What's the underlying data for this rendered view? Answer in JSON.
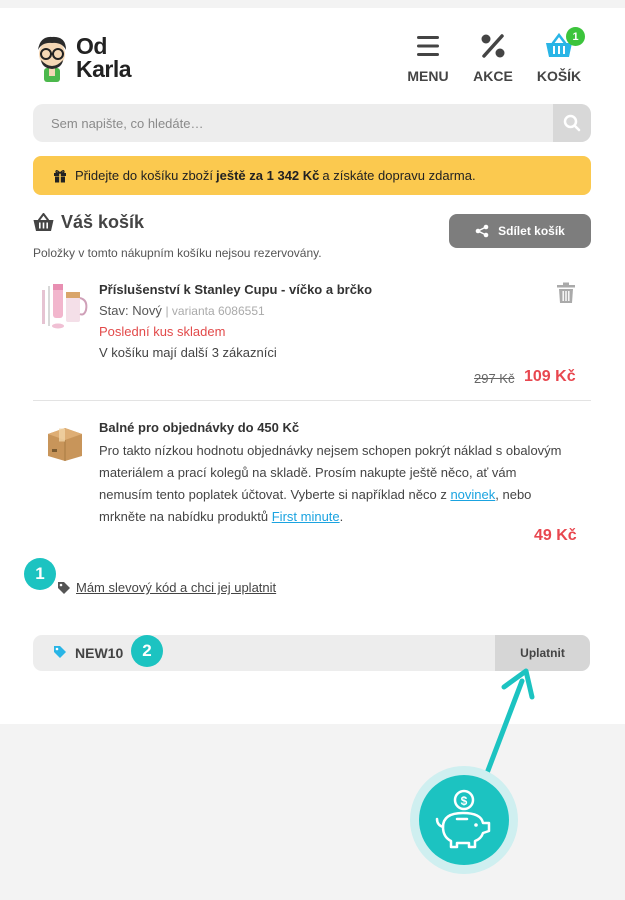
{
  "header": {
    "logo_line1": "Od",
    "logo_line2": "Karla",
    "nav": [
      {
        "label": "MENU",
        "icon": "hamburger-icon"
      },
      {
        "label": "AKCE",
        "icon": "percent-icon"
      },
      {
        "label": "KOŠÍK",
        "icon": "basket-icon",
        "badge": "1"
      }
    ]
  },
  "search": {
    "placeholder": "Sem napište, co hledáte…"
  },
  "banner": {
    "prefix": "Přidejte do košíku zboží",
    "highlight": "ještě za 1 342 Kč",
    "suffix": "a získáte dopravu zdarma."
  },
  "cart": {
    "title": "Váš košík",
    "note": "Položky v tomto nákupním košíku nejsou rezervovány.",
    "share_label": "Sdílet košík",
    "items": [
      {
        "name": "Příslušenství k Stanley Cupu - víčko a brčko",
        "state": "Stav: Nový",
        "variant": "| varianta 6086551",
        "stock": "Poslední kus skladem",
        "others": "V košíku mají další 3 zákazníci",
        "old_price": "297 Kč",
        "price": "109 Kč"
      },
      {
        "name": "Balné pro objednávky do 450 Kč",
        "desc_part1": "Pro takto nízkou hodnotu objednávky nejsem schopen pokrýt náklad s obalovým materiálem a prací kolegů na skladě. Prosím nakupte ještě něco, ať vám nemusím tento poplatek účtovat. Vyberte si například něco z",
        "link1": "novinek",
        "desc_part2": ", nebo mrkněte na nabídku produktů",
        "link2": "First minute",
        "desc_part3": ".",
        "price": "49 Kč"
      }
    ]
  },
  "discount": {
    "step1": "1",
    "step2": "2",
    "link_text": "Mám slevový kód a chci jej uplatnit",
    "code_value": "NEW10",
    "apply_label": "Uplatnit"
  },
  "colors": {
    "accent": "#1cc3c1",
    "banner": "#fbc94f",
    "price": "#e8474f",
    "stock": "#e24a4a",
    "link": "#1aa3e0",
    "badge": "#3cc43c"
  }
}
